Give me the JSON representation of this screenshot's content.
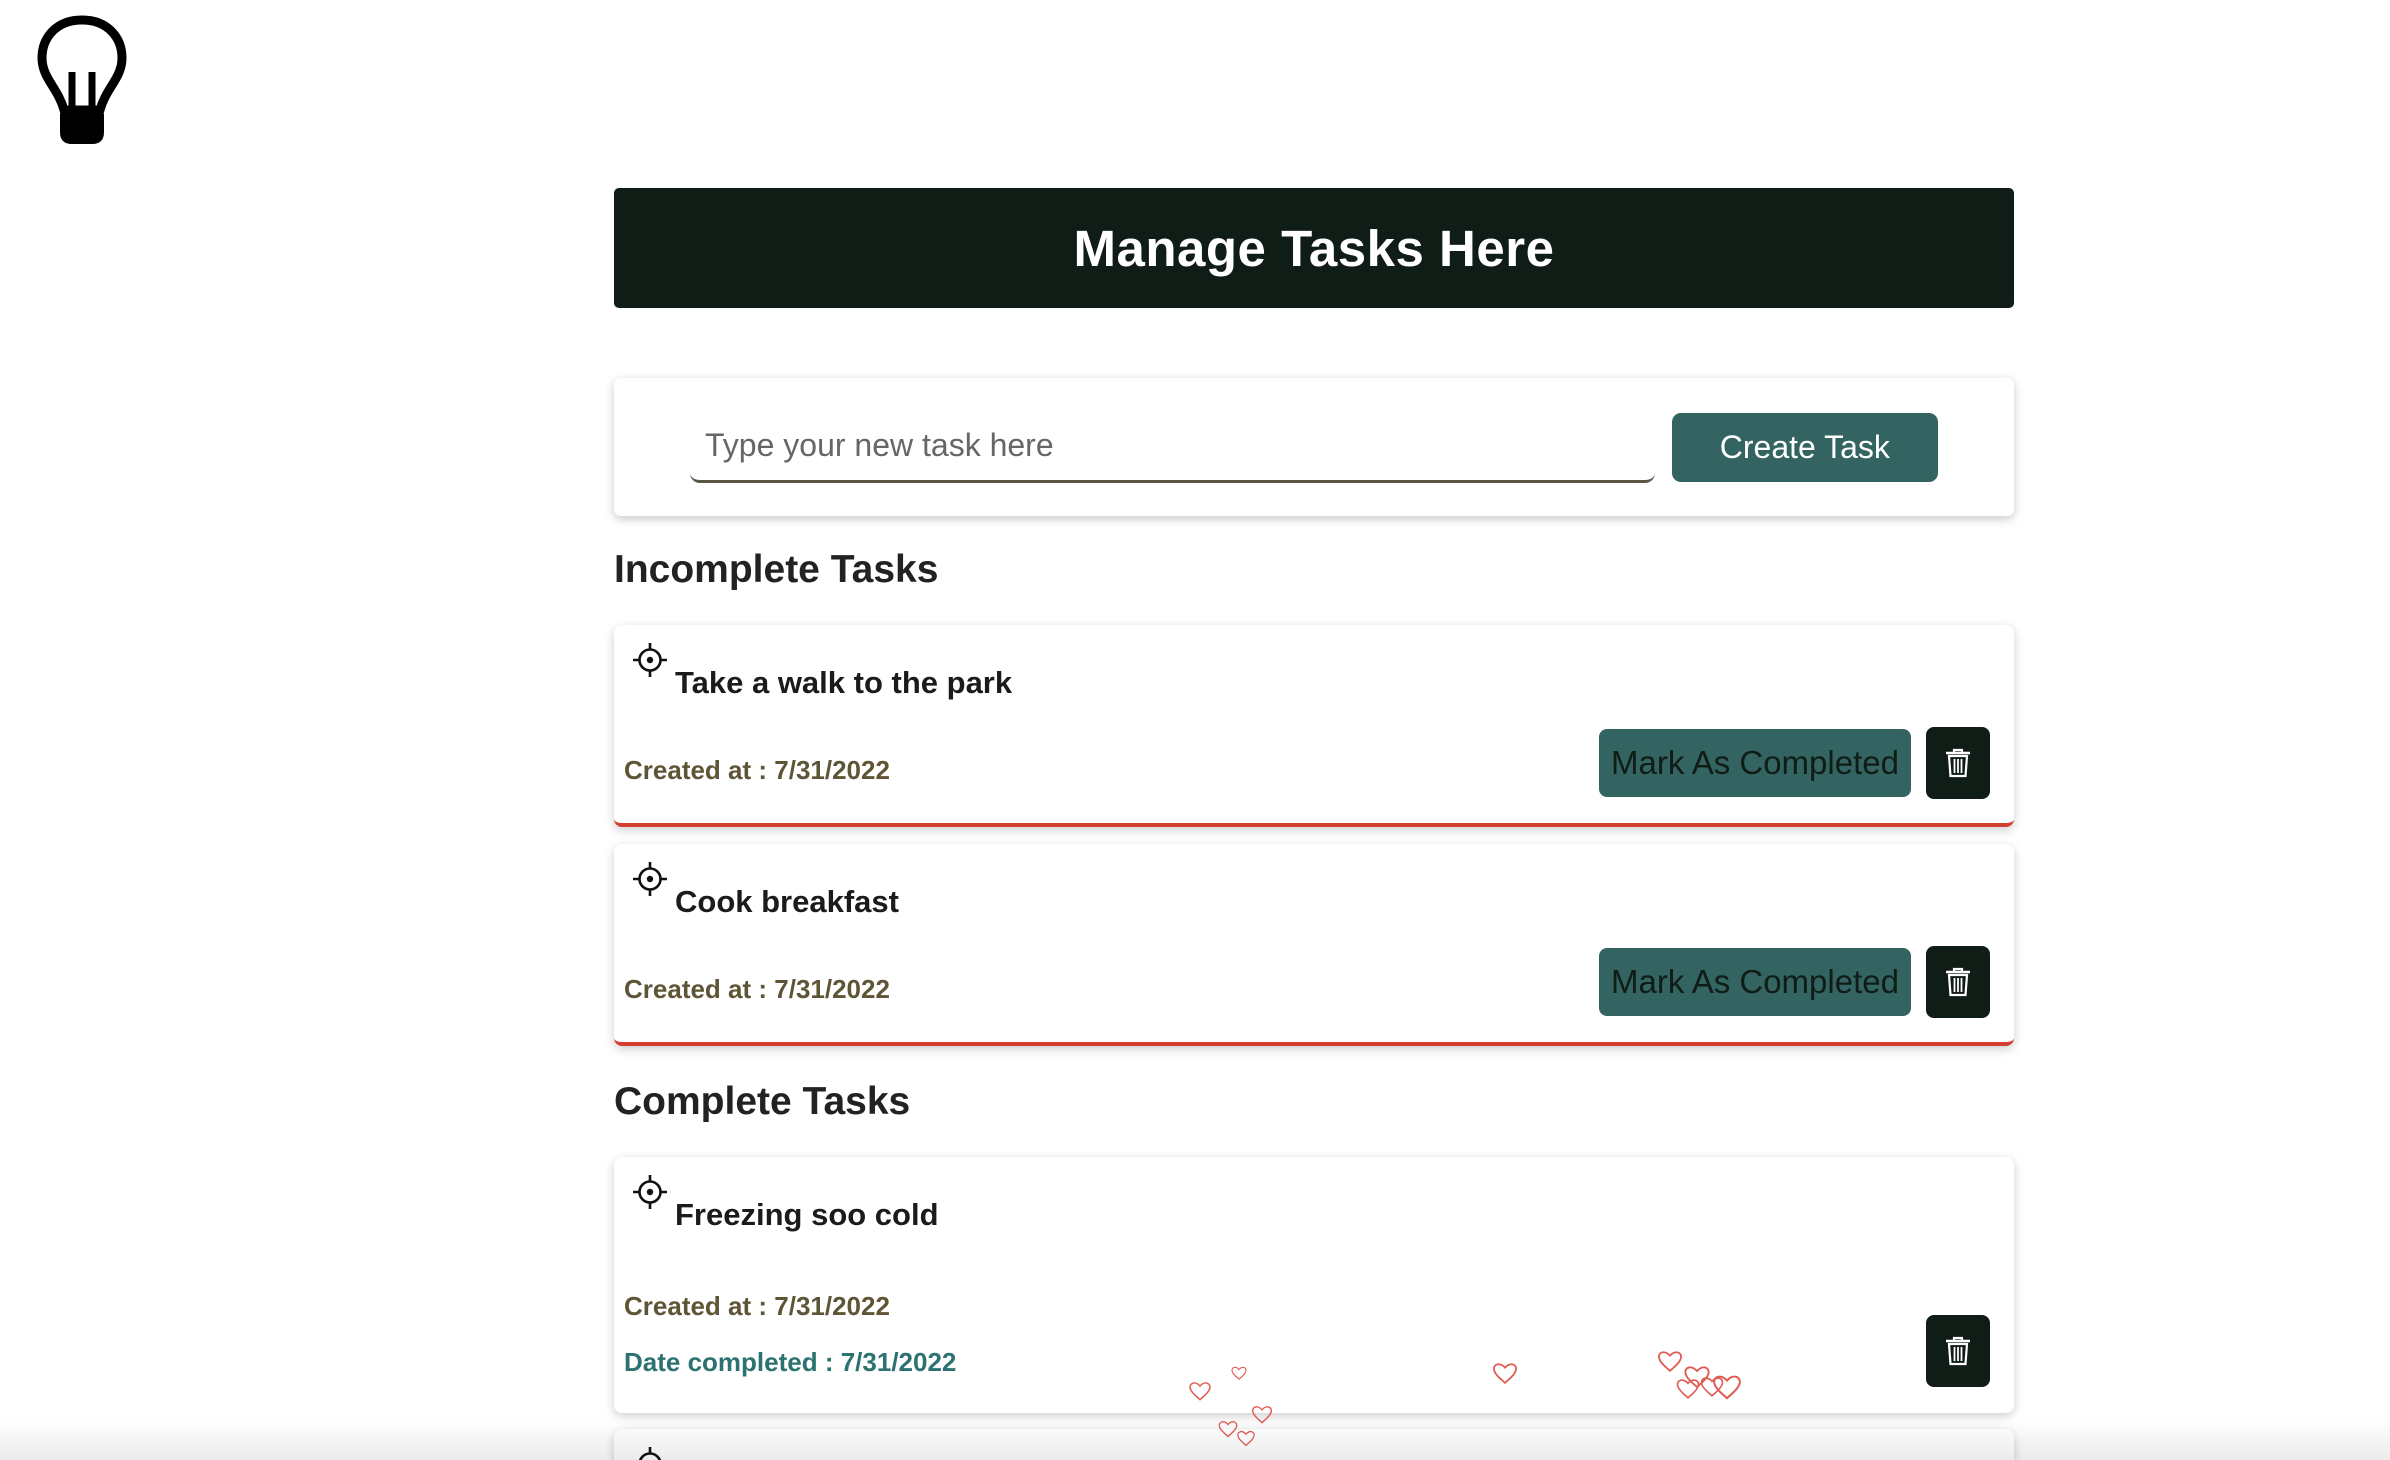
{
  "header": {
    "title": "Manage Tasks Here"
  },
  "create": {
    "placeholder": "Type your new task here",
    "button_label": "Create Task"
  },
  "sections": {
    "incomplete_title": "Incomplete Tasks",
    "complete_title": "Complete Tasks"
  },
  "incomplete_tasks": [
    {
      "title": "Take a walk to the park",
      "created": "Created at : 7/31/2022",
      "action_label": "Mark As Completed"
    },
    {
      "title": "Cook breakfast",
      "created": "Created at : 7/31/2022",
      "action_label": "Mark As Completed"
    }
  ],
  "complete_tasks": [
    {
      "title": "Freezing soo cold",
      "created": "Created at : 7/31/2022",
      "completed": "Date completed : 7/31/2022"
    }
  ],
  "icons": {
    "logo": "lightbulb-icon",
    "task": "crosshair-icon",
    "delete": "trash-icon",
    "decoration": "heart-icon"
  },
  "colors": {
    "header_bg": "#101c16",
    "button_bg": "#336462",
    "incomplete_border": "#d33f2f",
    "created_text": "#5e5536",
    "completed_text": "#2c7270"
  }
}
